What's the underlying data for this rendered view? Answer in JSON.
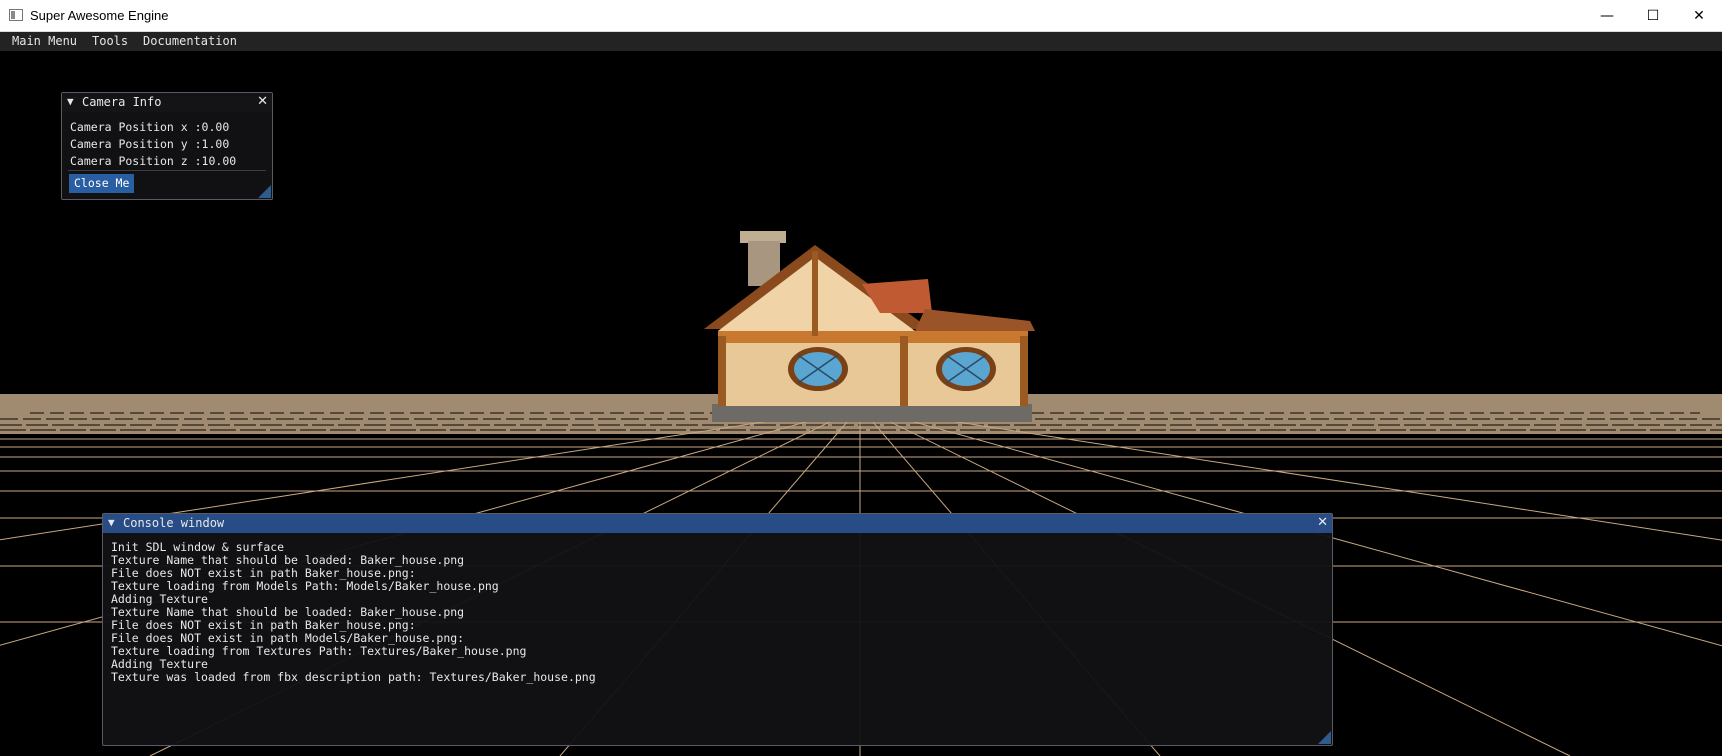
{
  "window": {
    "title": "Super Awesome Engine",
    "minimize_glyph": "—",
    "maximize_glyph": "☐",
    "close_glyph": "✕"
  },
  "menu": [
    "Main Menu",
    "Tools",
    "Documentation"
  ],
  "camera_window": {
    "title": "Camera Info",
    "close_glyph": "✕",
    "lines": [
      "Camera Position x :0.00",
      "Camera Position y :1.00",
      "Camera Position z :10.00"
    ],
    "button": "Close Me"
  },
  "console_window": {
    "title": "Console window",
    "close_glyph": "✕",
    "lines": [
      "Init SDL window & surface",
      "Texture Name that should be loaded: Baker_house.png",
      "File does NOT exist in path Baker_house.png:",
      "Texture loading from Models Path: Models/Baker_house.png",
      "Adding Texture",
      "Texture Name that should be loaded: Baker_house.png",
      "File does NOT exist in path Baker_house.png:",
      "File does NOT exist in path Models/Baker_house.png:",
      "Texture loading from Textures Path: Textures/Baker_house.png",
      "Adding Texture",
      "Texture was loaded from fbx description path: Textures/Baker_house.png"
    ]
  },
  "icons": {
    "app": "app-window-icon",
    "collapse": "collapse-triangle-icon"
  },
  "colors": {
    "menubar_bg": "#232323",
    "console_title_bg": "#284c86",
    "button_bg": "#2a5ea3",
    "ground": "#a08b70",
    "grid": "#c8a882"
  }
}
